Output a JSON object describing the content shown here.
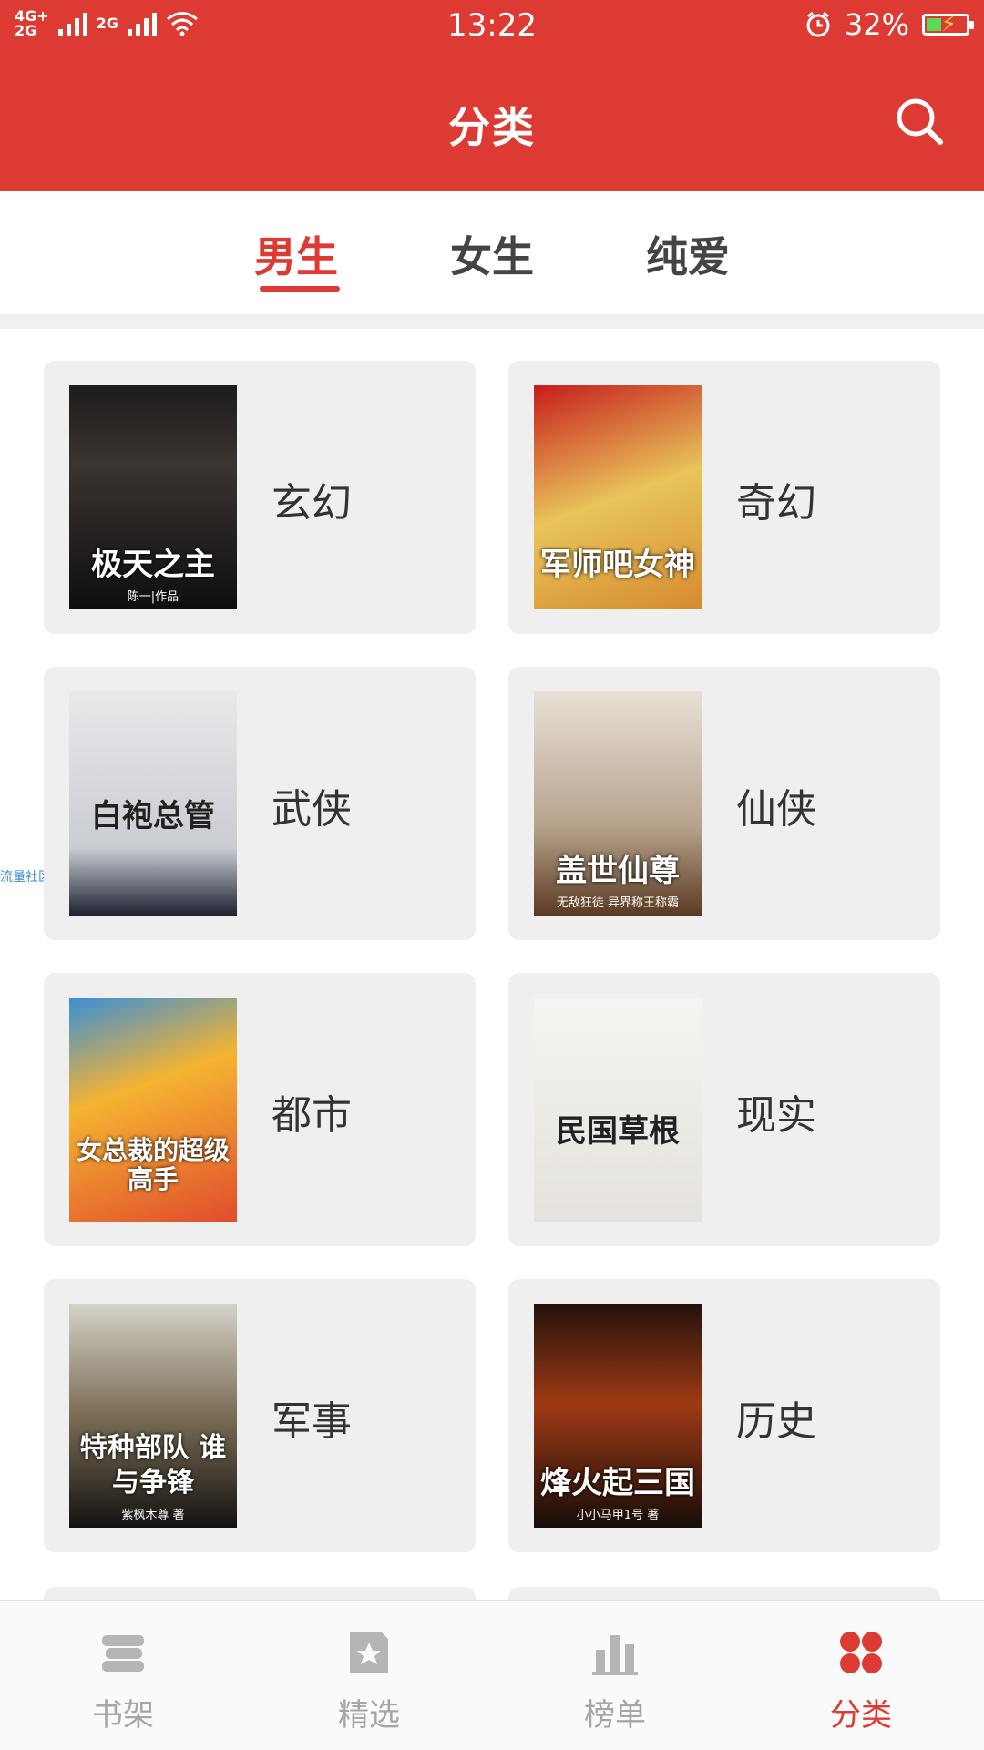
{
  "status_bar": {
    "network_top": "4G+",
    "network_bottom": "2G",
    "network2": "2G",
    "time": "13:22",
    "battery_percent": "32%",
    "battery_level": 0.32
  },
  "header": {
    "title": "分类",
    "search_icon": "search-icon"
  },
  "tabs": [
    {
      "label": "男生",
      "active": true
    },
    {
      "label": "女生",
      "active": false
    },
    {
      "label": "纯爱",
      "active": false
    }
  ],
  "side_note": "流量社区",
  "categories": [
    {
      "label": "玄幻",
      "cover_title": "极天之主",
      "cover_author": "陈一|作品"
    },
    {
      "label": "奇幻",
      "cover_title": "军师吧女神",
      "cover_author": ""
    },
    {
      "label": "武侠",
      "cover_title": "白袍总管",
      "cover_author": ""
    },
    {
      "label": "仙侠",
      "cover_title": "盖世仙尊",
      "cover_author": "无敌狂徒 异界称王称霸"
    },
    {
      "label": "都市",
      "cover_title": "女总裁的超级高手",
      "cover_author": ""
    },
    {
      "label": "现实",
      "cover_title": "民国草根",
      "cover_author": ""
    },
    {
      "label": "军事",
      "cover_title": "特种部队 谁与争锋",
      "cover_author": "紫枫木尊 著"
    },
    {
      "label": "历史",
      "cover_title": "烽火起三国",
      "cover_author": "小小马甲1号 著"
    }
  ],
  "bottom_nav": [
    {
      "label": "书架",
      "icon": "bookshelf-icon",
      "active": false
    },
    {
      "label": "精选",
      "icon": "featured-star-icon",
      "active": false
    },
    {
      "label": "榜单",
      "icon": "ranking-bars-icon",
      "active": false
    },
    {
      "label": "分类",
      "icon": "category-grid-icon",
      "active": true
    }
  ],
  "colors": {
    "primary": "#dc3a33",
    "inactive": "#a6a6a6",
    "card_bg": "#efefef"
  }
}
